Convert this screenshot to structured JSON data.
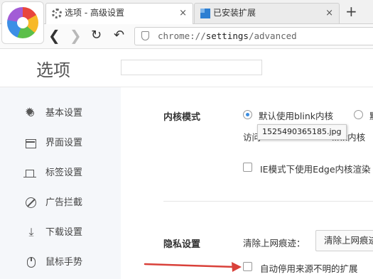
{
  "tabs": [
    {
      "label": "选项 - 高级设置",
      "close": "×",
      "icon": "gear-icon"
    },
    {
      "label": "已安装扩展",
      "close": "×",
      "icon": "extension-icon"
    }
  ],
  "new_tab": "+",
  "toolbar": {
    "url_scheme": "chrome://",
    "url_host": "settings",
    "url_path": "/advanced"
  },
  "header": {
    "title": "选项",
    "search_placeholder": ""
  },
  "sidebar": {
    "items": [
      {
        "label": "基本设置",
        "icon": "sun-icon"
      },
      {
        "label": "界面设置",
        "icon": "window-icon"
      },
      {
        "label": "标签设置",
        "icon": "tab-icon"
      },
      {
        "label": "广告拦截",
        "icon": "block-icon"
      },
      {
        "label": "下载设置",
        "icon": "download-icon"
      },
      {
        "label": "鼠标手势",
        "icon": "mouse-icon"
      }
    ]
  },
  "main": {
    "kernel": {
      "title": "内核模式",
      "option_default": "默认使用blink内核",
      "option_second_partial": "默",
      "access_prefix": "访问",
      "access_suffix": "link内核",
      "ie_edge": "IE模式下使用Edge内核渲染",
      "tooltip": "1525490365185.jpg"
    },
    "privacy": {
      "title": "隐私设置",
      "clear_label": "清除上网痕迹：",
      "clear_button": "清除上网痕迹",
      "auto_disable": "自动停用来源不明的扩展"
    }
  },
  "colors": {
    "accent": "#3b8de0",
    "arrow": "#d9413a",
    "sidebar_bg": "#f5f7fa"
  }
}
